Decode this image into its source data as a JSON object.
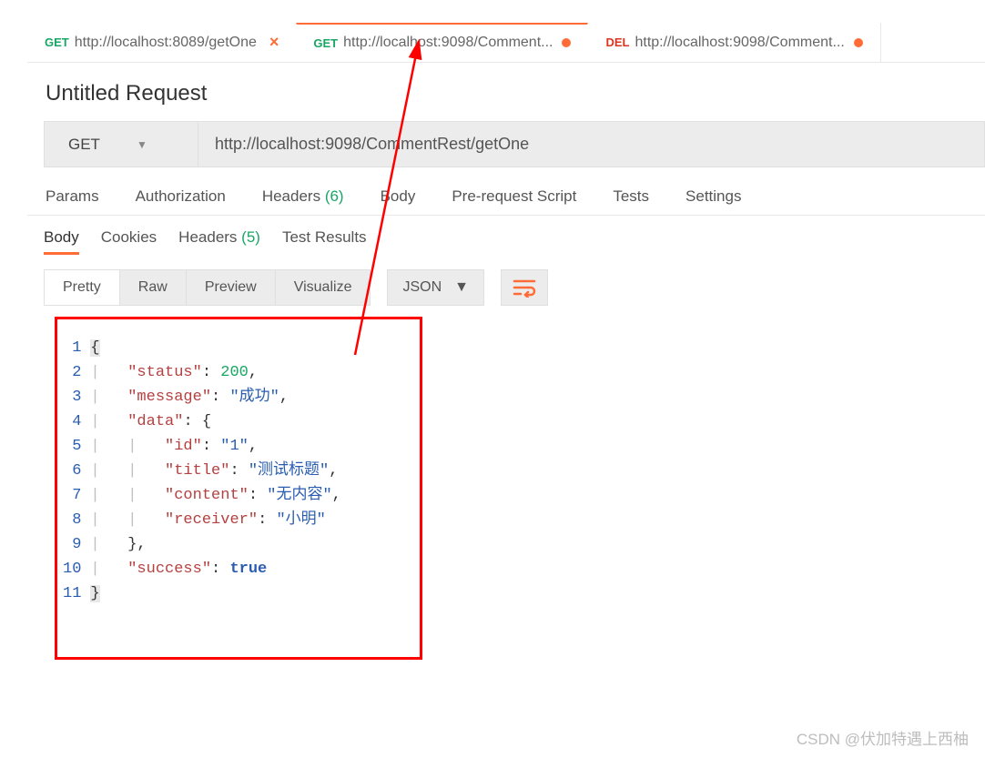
{
  "tabs": [
    {
      "method": "GET",
      "method_class": "method-get",
      "label": "http://localhost:8089/getOne",
      "has_close": true,
      "has_dot": false,
      "active": false
    },
    {
      "method": "GET",
      "method_class": "method-get",
      "label": "http://localhost:9098/Comment...",
      "has_close": false,
      "has_dot": true,
      "active": true
    },
    {
      "method": "DEL",
      "method_class": "method-del",
      "label": "http://localhost:9098/Comment...",
      "has_close": false,
      "has_dot": true,
      "active": false
    }
  ],
  "request_title": "Untitled Request",
  "method_selected": "GET",
  "url": "http://localhost:9098/CommentRest/getOne",
  "req_tabs": {
    "params": "Params",
    "authorization": "Authorization",
    "headers": "Headers",
    "headers_count": "(6)",
    "body": "Body",
    "prerequest": "Pre-request Script",
    "tests": "Tests",
    "settings": "Settings"
  },
  "resp_tabs": {
    "body": "Body",
    "cookies": "Cookies",
    "headers": "Headers",
    "headers_count": "(5)",
    "test_results": "Test Results"
  },
  "view_buttons": {
    "pretty": "Pretty",
    "raw": "Raw",
    "preview": "Preview",
    "visualize": "Visualize"
  },
  "format_select": "JSON",
  "code_lines": [
    "1",
    "2",
    "3",
    "4",
    "5",
    "6",
    "7",
    "8",
    "9",
    "10",
    "11"
  ],
  "json": {
    "k_status": "\"status\"",
    "v_status": "200",
    "k_message": "\"message\"",
    "v_message": "\"成功\"",
    "k_data": "\"data\"",
    "k_id": "\"id\"",
    "v_id": "\"1\"",
    "k_title": "\"title\"",
    "v_title": "\"测试标题\"",
    "k_content": "\"content\"",
    "v_content": "\"无内容\"",
    "k_receiver": "\"receiver\"",
    "v_receiver": "\"小明\"",
    "k_success": "\"success\"",
    "v_success": "true",
    "brace_open": "{",
    "brace_close": "}",
    "brace_close_comma": "},",
    "colon": ": ",
    "comma": ","
  },
  "watermark": "CSDN @伏加特遇上西柚"
}
